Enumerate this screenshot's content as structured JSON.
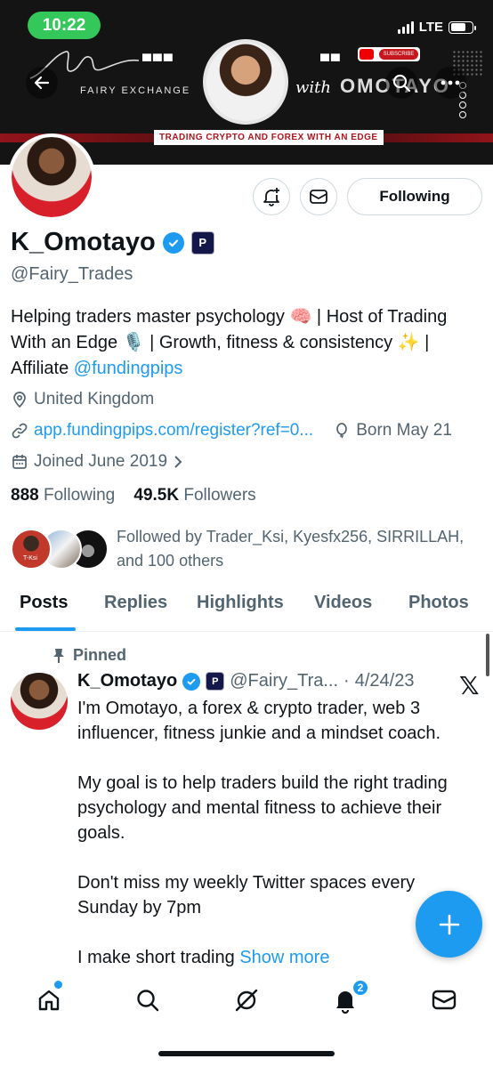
{
  "status_bar": {
    "time": "10:22",
    "network": "LTE"
  },
  "banner": {
    "brand": "FAIRY EXCHANGE",
    "with_text": "with",
    "name_text": "OMOTAYO",
    "tagline": "TRADING CRYPTO AND FOREX WITH AN EDGE",
    "subscribe": "SUBSCRIBE"
  },
  "profile": {
    "display_name": "K_Omotayo",
    "affiliate_badge": "P",
    "handle": "@Fairy_Trades",
    "following_button": "Following",
    "bio_text": "Helping traders master psychology 🧠 | Host of Trading With an Edge 🎙️ | Growth, fitness & consistency ✨ | Affiliate ",
    "bio_mention": "@fundingpips",
    "location": "United Kingdom",
    "website": "app.fundingpips.com/register?ref=0...",
    "birthday": "Born May 21",
    "joined": "Joined June 2019",
    "following_count": "888",
    "following_label": "Following",
    "followers_count": "49.5K",
    "followers_label": "Followers",
    "followed_by": "Followed by Trader_Ksi, Kyesfx256, SIRRILLAH, and 100 others",
    "follower_avatar_label": "T-Ksi"
  },
  "tabs": [
    {
      "label": "Posts",
      "active": true
    },
    {
      "label": "Replies"
    },
    {
      "label": "Highlights"
    },
    {
      "label": "Videos"
    },
    {
      "label": "Photos"
    }
  ],
  "pinned_tweet": {
    "pinned_label": "Pinned",
    "author": "K_Omotayo",
    "handle": "@Fairy_Tra...",
    "separator": "·",
    "date": "4/24/23",
    "body": "I'm Omotayo, a forex & crypto trader, web 3 influencer, fitness junkie and a mindset coach.\n\nMy goal is to help traders build the right trading psychology and mental fitness to achieve their goals.\n\nDon't miss my weekly Twitter spaces every Sunday by 7pm\n\nI make short trading ",
    "show_more": "Show more"
  },
  "bottom_nav": {
    "notifications_badge": "2"
  },
  "colors": {
    "accent": "#1d9bf0",
    "status_green": "#34c759",
    "text": "#0f1419",
    "muted": "#536471"
  },
  "icons": [
    "back-icon",
    "search-icon",
    "more-icon",
    "notification-bell-plus-icon",
    "message-icon",
    "verified-icon",
    "location-icon",
    "link-icon",
    "balloon-icon",
    "calendar-icon",
    "chevron-right-icon",
    "pin-icon",
    "x-logo-icon",
    "compose-plus-icon",
    "home-icon",
    "grok-icon",
    "bell-icon",
    "mail-icon"
  ]
}
